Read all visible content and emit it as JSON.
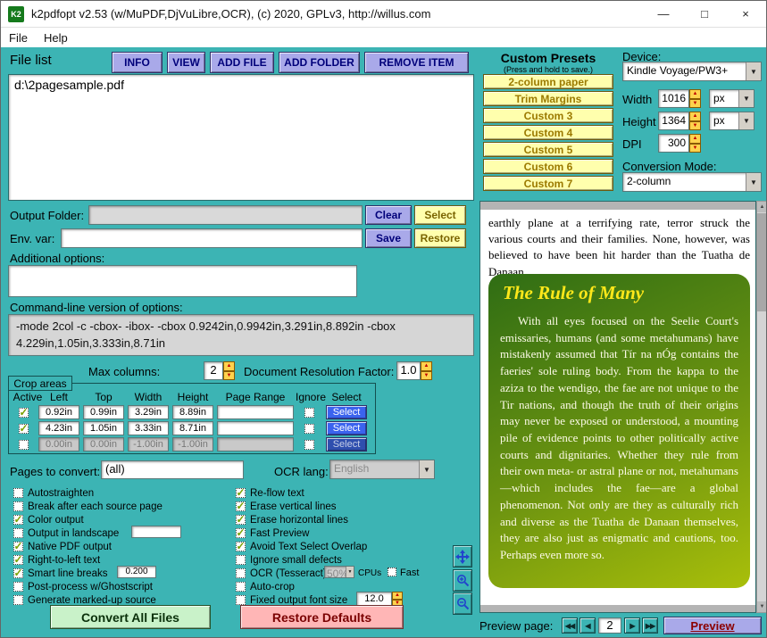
{
  "window": {
    "title": "k2pdfopt v2.53 (w/MuPDF,DjVuLibre,OCR), (c) 2020, GPLv3, http://willus.com",
    "logo_text": "K2"
  },
  "icons": {
    "minimize": "—",
    "maximize": "□",
    "close": "×",
    "dropdown": "▼",
    "spin_up": "▲",
    "spin_down": "▼",
    "scroll_up": "▲",
    "scroll_down": "▼",
    "nav_first": "◀◀",
    "nav_prev": "◀",
    "nav_next": "▶",
    "nav_last": "▶▶",
    "check": "✓"
  },
  "menu": {
    "file": "File",
    "help": "Help"
  },
  "left": {
    "file_list_label": "File list",
    "toolbar": {
      "info": "INFO",
      "view": "VIEW",
      "add_file": "ADD FILE",
      "add_folder": "ADD FOLDER",
      "remove_item": "REMOVE ITEM"
    },
    "files": [
      "d:\\2pagesample.pdf"
    ],
    "output_folder": {
      "label": "Output Folder:",
      "value": "",
      "clear": "Clear",
      "select": "Select"
    },
    "env_var": {
      "label": "Env. var:",
      "value": "",
      "save": "Save",
      "restore": "Restore"
    },
    "additional_options": {
      "label": "Additional options:",
      "value": ""
    },
    "cmdline": {
      "label": "Command-line version of options:",
      "value": "-mode 2col -c -cbox- -ibox- -cbox 0.9242in,0.9942in,3.291in,8.892in -cbox 4.229in,1.05in,3.333in,8.71in"
    },
    "max_columns": {
      "label": "Max columns:",
      "value": "2"
    },
    "doc_res": {
      "label": "Document Resolution Factor:",
      "value": "1.0"
    },
    "crop_areas": {
      "label": "Crop areas",
      "headers": [
        "Active",
        "Left",
        "Top",
        "Width",
        "Height",
        "Page Range",
        "Ignore",
        "Select"
      ],
      "rows": [
        {
          "active": true,
          "left": "0.92in",
          "top": "0.99in",
          "width": "3.29in",
          "height": "8.89in",
          "page_range": "",
          "ignore": false,
          "select": "Select"
        },
        {
          "active": true,
          "left": "4.23in",
          "top": "1.05in",
          "width": "3.33in",
          "height": "8.71in",
          "page_range": "",
          "ignore": false,
          "select": "Select"
        },
        {
          "active": false,
          "left": "0.00in",
          "top": "0.00in",
          "width": "-1.00in",
          "height": "-1.00in",
          "page_range": "",
          "ignore": false,
          "select": "Select"
        }
      ]
    },
    "pages_to_convert": {
      "label": "Pages to convert:",
      "value": "(all)"
    },
    "ocr_lang": {
      "label": "OCR lang:",
      "value": "English"
    },
    "options_left": [
      {
        "label": "Autostraighten",
        "checked": false
      },
      {
        "label": "Break after each source page",
        "checked": false
      },
      {
        "label": "Color output",
        "checked": true
      },
      {
        "label": "Output in landscape",
        "checked": false,
        "extra_input": ""
      },
      {
        "label": "Native PDF output",
        "checked": true
      },
      {
        "label": "Right-to-left text",
        "checked": true
      },
      {
        "label": "Smart line breaks",
        "checked": true,
        "extra_input": "0.200"
      },
      {
        "label": "Post-process w/Ghostscript",
        "checked": false
      },
      {
        "label": "Generate marked-up source",
        "checked": false
      }
    ],
    "options_right": [
      {
        "label": "Re-flow text",
        "checked": true
      },
      {
        "label": "Erase vertical lines",
        "checked": true
      },
      {
        "label": "Erase horizontal lines",
        "checked": true
      },
      {
        "label": "Fast Preview",
        "checked": true
      },
      {
        "label": "Avoid Text Select Overlap",
        "checked": true
      },
      {
        "label": "Ignore small defects",
        "checked": false
      },
      {
        "label": "OCR (Tesseract)",
        "checked": false,
        "cpu_pct": "50%",
        "cpu_label": "CPUs",
        "fast_label": "Fast",
        "fast_checked": false
      },
      {
        "label": "Auto-crop",
        "checked": false
      },
      {
        "label": "Fixed output font size",
        "checked": false,
        "size": "12.0"
      }
    ],
    "convert_button": "Convert All Files",
    "restore_button": "Restore Defaults"
  },
  "presets": {
    "title": "Custom Presets",
    "subtitle": "(Press and hold to save.)",
    "buttons": [
      "2-column paper",
      "Trim Margins",
      "Custom 3",
      "Custom 4",
      "Custom 5",
      "Custom 6",
      "Custom 7"
    ]
  },
  "device": {
    "label": "Device:",
    "value": "Kindle Voyage/PW3+",
    "width": {
      "label": "Width",
      "value": "1016",
      "unit": "px"
    },
    "height": {
      "label": "Height",
      "value": "1364",
      "unit": "px"
    },
    "dpi": {
      "label": "DPI",
      "value": "300"
    },
    "conversion_mode": {
      "label": "Conversion Mode:",
      "value": "2-column"
    }
  },
  "preview": {
    "intro_text": "earthly plane at a terrifying rate, terror struck the various courts and their families. None, however, was believed to have been hit harder than the Tuatha de Danaan.",
    "box_title": "The Rule of Many",
    "box_text": "With all eyes focused on the Seelie Court's emissaries, humans (and some metahumans) have mistakenly assumed that Tír na nÓg contains the faeries' sole ruling body. From the kappa to the aziza to the wendigo, the fae are not unique to the Tir nations, and though the truth of their origins may never be exposed or understood, a mounting pile of evidence points to other politically active courts and dignitaries. Whether they rule from their own meta- or astral plane or not, metahumans—which includes the fae—are a global phenomenon. Not only are they as culturally rich and diverse as the Tuatha de Danaan themselves, they are also just as enigmatic and cautions, too. Perhaps even more so.",
    "page_label": "Preview page:",
    "page_value": "2",
    "preview_button": "Preview"
  }
}
